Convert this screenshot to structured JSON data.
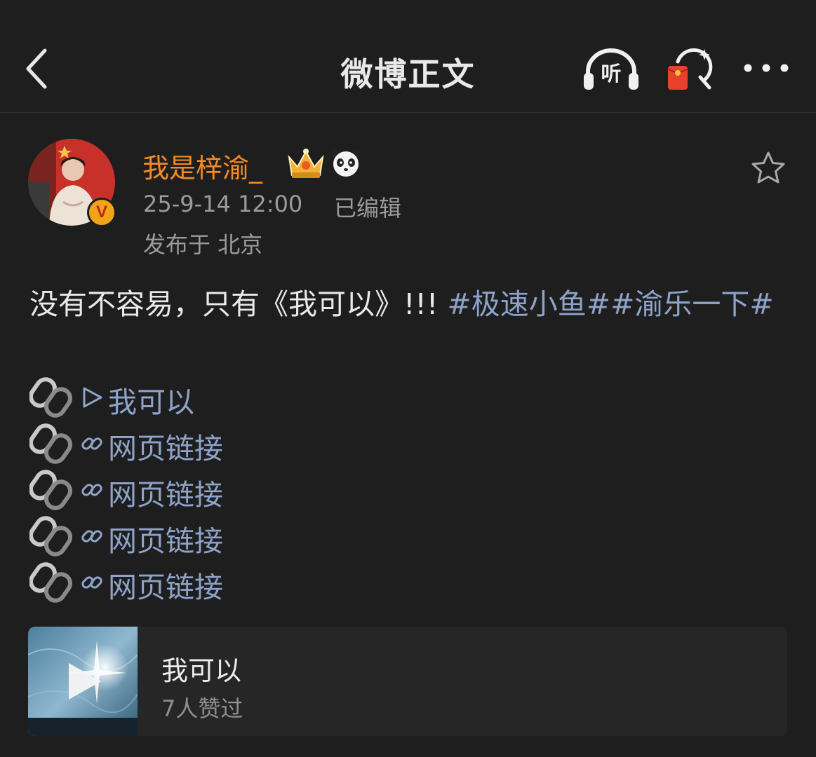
{
  "header": {
    "title": "微博正文",
    "listen_label": "听"
  },
  "post": {
    "author": {
      "name": "我是梓渝_",
      "verified_badge": "V"
    },
    "time": "25-9-14 12:00",
    "edited_label": "已编辑",
    "location": "发布于 北京",
    "text": "没有不容易，只有《我可以》!!!",
    "hashtags": [
      "#极速小鱼#",
      "#渝乐一下#"
    ],
    "links": [
      {
        "icon": "play-triangle-icon",
        "label": "我可以"
      },
      {
        "icon": "link-icon",
        "label": "网页链接"
      },
      {
        "icon": "link-icon",
        "label": "网页链接"
      },
      {
        "icon": "link-icon",
        "label": "网页链接"
      },
      {
        "icon": "link-icon",
        "label": "网页链接"
      }
    ]
  },
  "music_card": {
    "title": "我可以",
    "likes": "7人赞过"
  },
  "colors": {
    "background": "#1e1e1e",
    "username": "#f58a25",
    "link": "#8ea3c9",
    "secondary_text": "#9b9b9b"
  }
}
